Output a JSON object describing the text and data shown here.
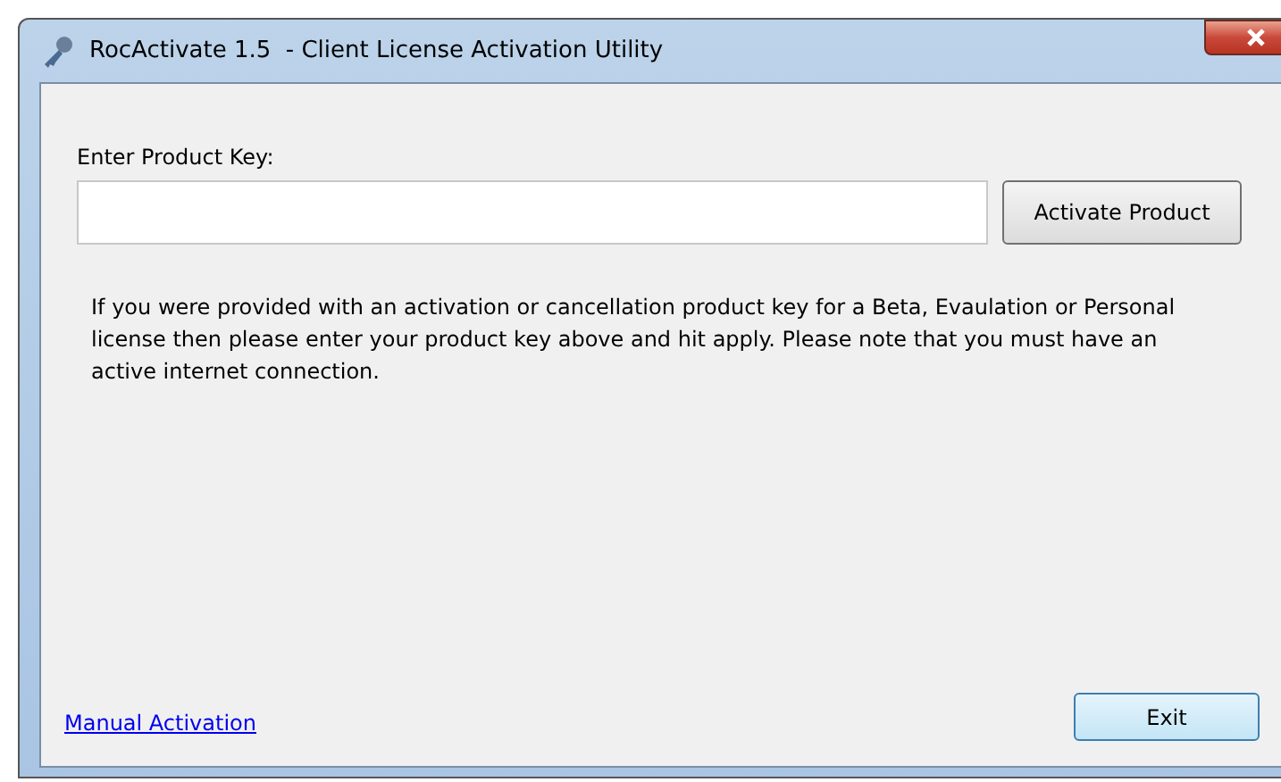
{
  "window": {
    "title": "RocActivate 1.5  - Client License Activation Utility"
  },
  "product_key": {
    "label": "Enter Product Key:"
  },
  "activate_button": "Activate Product",
  "info": "If you were provided with an activation or cancellation product key for a Beta, Evaulation or Personal license then please enter your product key above and hit apply. Please note that you must have an active internet connection.",
  "manual_link": "Manual Activation",
  "exit_button": "Exit"
}
